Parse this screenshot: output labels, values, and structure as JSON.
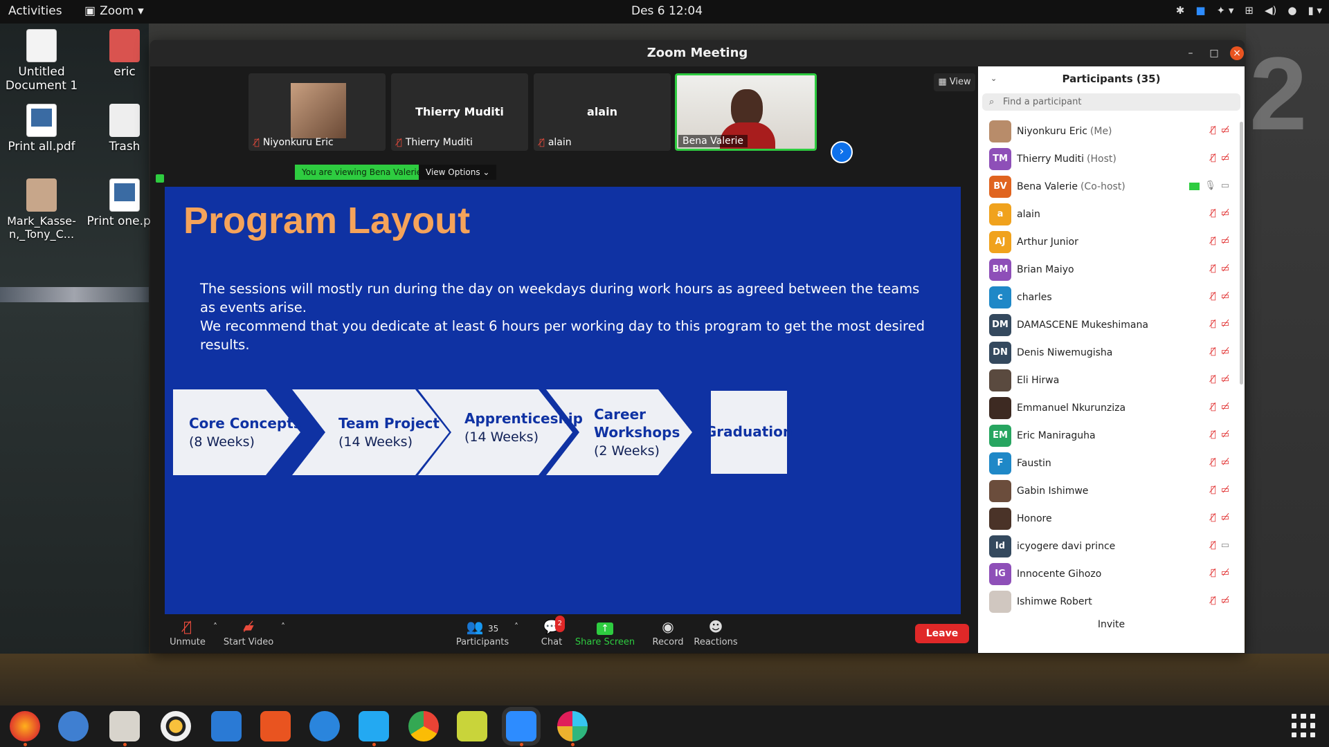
{
  "topbar": {
    "activities": "Activities",
    "app_name": "Zoom",
    "clock": "Des 6  12:04"
  },
  "desktop": {
    "icons": [
      {
        "label": "Untitled Document 1"
      },
      {
        "label": "eric"
      },
      {
        "label": "Print all.pdf"
      },
      {
        "label": "Trash"
      },
      {
        "label": "Mark_Kasse-n,_Tony_C..."
      },
      {
        "label": "Print one.pdf"
      }
    ]
  },
  "zoom": {
    "title": "Zoom Meeting",
    "view_label": "View",
    "thumbnails": [
      {
        "name": "Niyonkuru Eric",
        "muted": true
      },
      {
        "name": "Thierry Muditi",
        "big_name": "Thierry Muditi",
        "muted": true
      },
      {
        "name": "alain",
        "big_name": "alain",
        "muted": true
      },
      {
        "name": "Bena Valerie",
        "muted": false,
        "active": true
      }
    ],
    "share_banner": "You are viewing Bena Valerie's screen",
    "view_options": "View Options",
    "slide": {
      "title": "Program Layout",
      "paragraph1": "The sessions will mostly run during the day on weekdays during work hours as agreed between the teams as events arise.",
      "paragraph2": "We recommend that you dedicate at least 6 hours per working day to this program to get the most desired results.",
      "steps": [
        {
          "title": "Core Concepts",
          "duration": "(8 Weeks)"
        },
        {
          "title": "Team Project",
          "duration": "(14 Weeks)"
        },
        {
          "title": "Apprenticeship",
          "duration": "(14 Weeks)"
        },
        {
          "title_line1": "Career",
          "title_line2": "Workshops",
          "duration": "(2 Weeks)"
        },
        {
          "title": "Graduation"
        }
      ]
    },
    "toolbar": {
      "unmute": "Unmute",
      "start_video": "Start Video",
      "participants": "Participants",
      "participants_count": "35",
      "chat": "Chat",
      "chat_badge": "2",
      "share_screen": "Share Screen",
      "record": "Record",
      "reactions": "Reactions",
      "leave": "Leave"
    },
    "panel": {
      "title": "Participants (35)",
      "search_placeholder": "Find a participant",
      "invite": "Invite",
      "participants": [
        {
          "initials": "",
          "name": "Niyonkuru Eric",
          "role": "(Me)",
          "color": "#b88c6a",
          "photo": true
        },
        {
          "initials": "TM",
          "name": "Thierry Muditi",
          "role": "(Host)",
          "color": "#8e4fb8"
        },
        {
          "initials": "BV",
          "name": "Bena Valerie",
          "role": "(Co-host)",
          "color": "#e0641f",
          "sharing": true
        },
        {
          "initials": "a",
          "name": "alain",
          "role": "",
          "color": "#f0a21d"
        },
        {
          "initials": "AJ",
          "name": "Arthur Junior",
          "role": "",
          "color": "#f0a21d"
        },
        {
          "initials": "BM",
          "name": "Brian Maiyo",
          "role": "",
          "color": "#8e4fb8"
        },
        {
          "initials": "c",
          "name": "charles",
          "role": "",
          "color": "#1f88c7"
        },
        {
          "initials": "DM",
          "name": "DAMASCENE Mukeshimana",
          "role": "",
          "color": "#34495e"
        },
        {
          "initials": "DN",
          "name": "Denis Niwemugisha",
          "role": "",
          "color": "#34495e"
        },
        {
          "initials": "",
          "name": "Eli Hirwa",
          "role": "",
          "color": "#5a4a3f",
          "photo": true
        },
        {
          "initials": "",
          "name": "Emmanuel Nkurunziza",
          "role": "",
          "color": "#3d2a22",
          "photo": true
        },
        {
          "initials": "EM",
          "name": "Eric Maniraguha",
          "role": "",
          "color": "#27a560"
        },
        {
          "initials": "F",
          "name": "Faustin",
          "role": "",
          "color": "#1f88c7"
        },
        {
          "initials": "",
          "name": "Gabin Ishimwe",
          "role": "",
          "color": "#6b4d3c",
          "photo": true
        },
        {
          "initials": "",
          "name": "Honore",
          "role": "",
          "color": "#4a3328",
          "photo": true
        },
        {
          "initials": "Id",
          "name": "icyogere davi prince",
          "role": "",
          "color": "#34495e",
          "video_grey": true
        },
        {
          "initials": "IG",
          "name": "Innocente Gihozo",
          "role": "",
          "color": "#8e4fb8"
        },
        {
          "initials": "",
          "name": "Ishimwe Robert",
          "role": "",
          "color": "#d0c7c0",
          "photo": true
        }
      ]
    }
  },
  "colors": {
    "slide_bg": "#0f32a3",
    "slide_title": "#f5a35a",
    "chevron": "#eef0f5",
    "step_text": "#0f32a3",
    "leave": "#e02828",
    "share_green": "#2ecc40"
  }
}
